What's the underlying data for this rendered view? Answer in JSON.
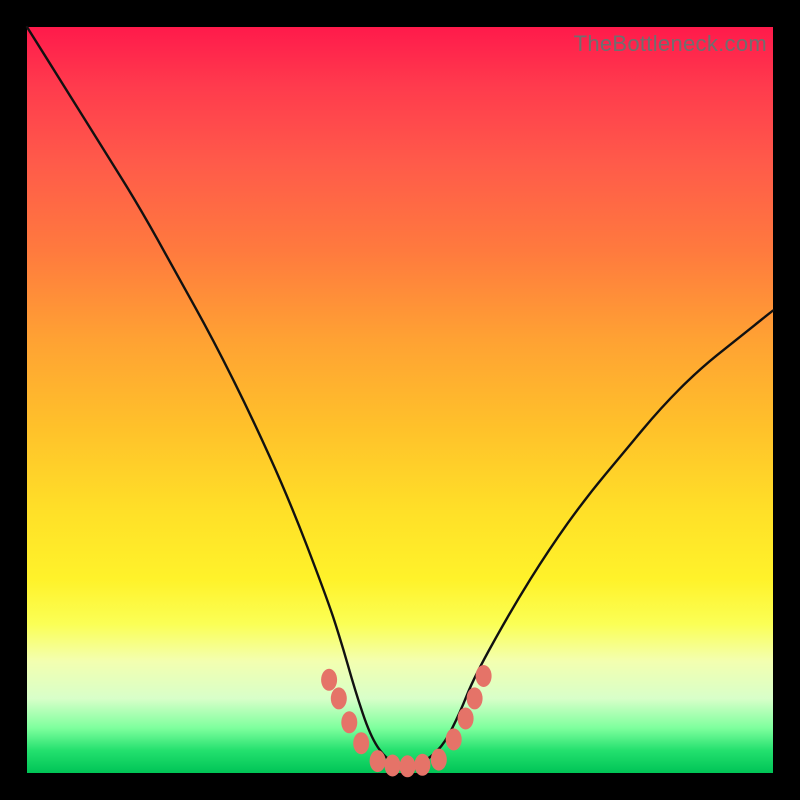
{
  "watermark": "TheBottleneck.com",
  "colors": {
    "page_bg": "#000000",
    "curve": "#111111",
    "bead": "#e57368"
  },
  "chart_data": {
    "type": "line",
    "title": "",
    "xlabel": "",
    "ylabel": "",
    "xlim": [
      0,
      100
    ],
    "ylim": [
      0,
      100
    ],
    "grid": false,
    "legend": false,
    "annotations": [],
    "series": [
      {
        "name": "bottleneck-curve",
        "x": [
          0,
          5,
          10,
          15,
          20,
          25,
          30,
          35,
          40,
          42,
          44,
          46,
          48,
          50,
          52,
          54,
          56,
          58,
          60,
          65,
          70,
          75,
          80,
          85,
          90,
          95,
          100
        ],
        "y": [
          100,
          92,
          84,
          76,
          67,
          58,
          48,
          37,
          24,
          18,
          11,
          5,
          2,
          1,
          1,
          2,
          4,
          8,
          13,
          22,
          30,
          37,
          43,
          49,
          54,
          58,
          62
        ]
      }
    ],
    "markers": [
      {
        "name": "left-bead-1",
        "x": 40.5,
        "y": 12.5
      },
      {
        "name": "left-bead-2",
        "x": 41.8,
        "y": 10.0
      },
      {
        "name": "left-bead-3",
        "x": 43.2,
        "y": 6.8
      },
      {
        "name": "left-bead-4",
        "x": 44.8,
        "y": 4.0
      },
      {
        "name": "flat-bead-1",
        "x": 47.0,
        "y": 1.6
      },
      {
        "name": "flat-bead-2",
        "x": 49.0,
        "y": 1.0
      },
      {
        "name": "flat-bead-3",
        "x": 51.0,
        "y": 0.9
      },
      {
        "name": "flat-bead-4",
        "x": 53.0,
        "y": 1.1
      },
      {
        "name": "flat-bead-5",
        "x": 55.2,
        "y": 1.8
      },
      {
        "name": "right-bead-1",
        "x": 57.2,
        "y": 4.5
      },
      {
        "name": "right-bead-2",
        "x": 58.8,
        "y": 7.3
      },
      {
        "name": "right-bead-3",
        "x": 60.0,
        "y": 10.0
      },
      {
        "name": "right-bead-4",
        "x": 61.2,
        "y": 13.0
      }
    ]
  }
}
